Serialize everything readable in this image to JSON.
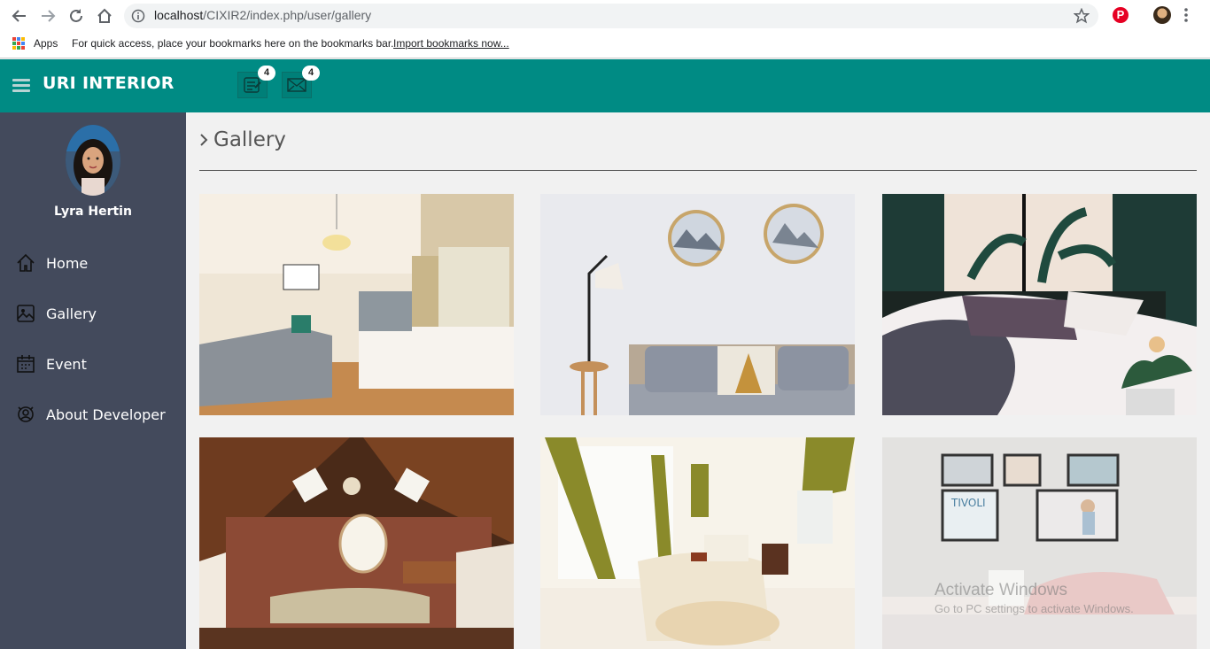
{
  "browser": {
    "url_host": "localhost",
    "url_path": "/CIXIR2/index.php/user/gallery",
    "bookmarks": {
      "apps_label": "Apps",
      "message": "For quick access, place your bookmarks here on the bookmarks bar.",
      "import_link": "Import bookmarks now..."
    }
  },
  "header": {
    "brand": "URI INTERIOR",
    "tasks_badge": "4",
    "messages_badge": "4",
    "color": "#008b84"
  },
  "sidebar": {
    "user_name": "Lyra Hertin",
    "items": [
      {
        "label": "Home",
        "icon": "home-icon"
      },
      {
        "label": "Gallery",
        "icon": "image-icon"
      },
      {
        "label": "Event",
        "icon": "calendar-icon"
      },
      {
        "label": "About Developer",
        "icon": "developer-icon"
      }
    ],
    "color": "#434a5c"
  },
  "main": {
    "title": "Gallery",
    "images": [
      {
        "alt": "Bedroom with pendant lamp and sofa bench"
      },
      {
        "alt": "Bedroom with round wall art and floor lamp"
      },
      {
        "alt": "Dark green bedroom with plants"
      },
      {
        "alt": "Attic bedroom with brick wall"
      },
      {
        "alt": "Bright bedroom with olive curtains"
      },
      {
        "alt": "Pastel bedroom with framed posters"
      }
    ]
  },
  "watermark": {
    "line1": "Activate Windows",
    "line2": "Go to PC settings to activate Windows."
  }
}
